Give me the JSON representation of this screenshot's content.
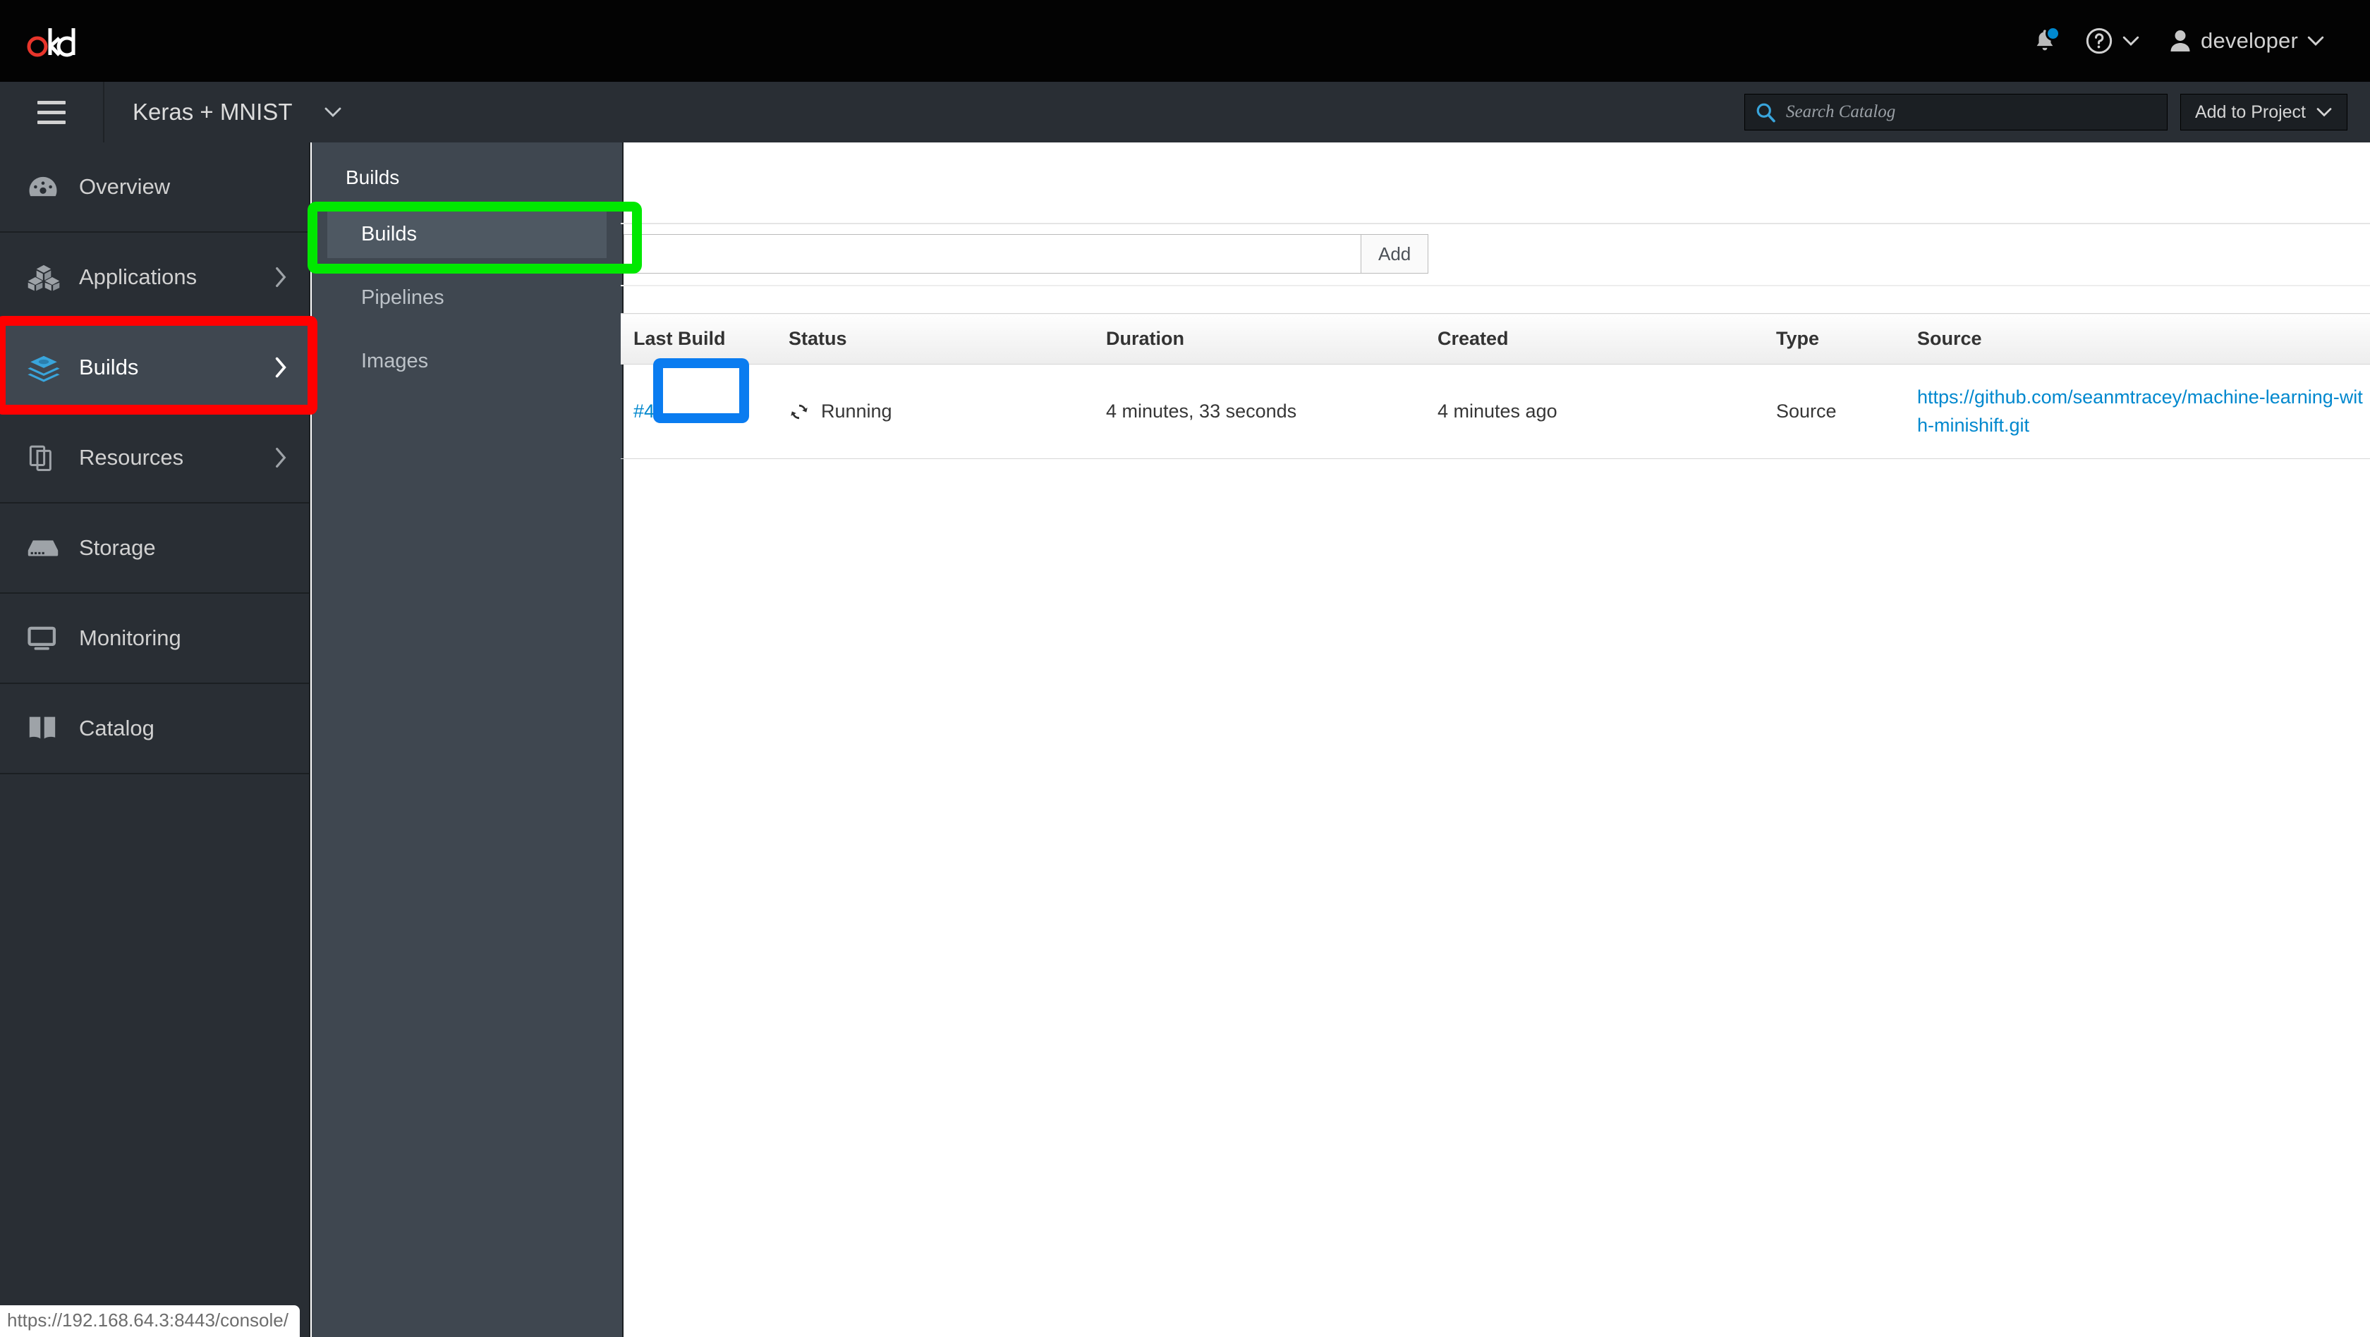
{
  "masthead": {
    "logo_text": "okd",
    "logo_color_accent": "#e8352b",
    "notifications_icon": "bell-icon",
    "notification_badge_color": "#0088ce",
    "help_icon": "help-circle-icon",
    "user_icon": "user-avatar-icon",
    "user_name": "developer"
  },
  "secondary_bar": {
    "menu_icon": "hamburger-menu-icon",
    "project_name": "Keras + MNIST",
    "project_caret_icon": "chevron-down-icon",
    "search": {
      "icon": "search-icon",
      "icon_color": "#39a5dc",
      "placeholder": "Search Catalog",
      "value": ""
    },
    "add_to_project_label": "Add to Project",
    "add_to_project_caret": "chevron-down-icon"
  },
  "sidebar": {
    "items": [
      {
        "label": "Overview",
        "icon": "dashboard-gauge-icon",
        "has_caret": false,
        "active": false
      },
      {
        "label": "Applications",
        "icon": "cubes-icon",
        "has_caret": true,
        "active": false
      },
      {
        "label": "Builds",
        "icon": "layers-stack-icon",
        "has_caret": true,
        "active": true
      },
      {
        "label": "Resources",
        "icon": "documents-icon",
        "has_caret": true,
        "active": false
      },
      {
        "label": "Storage",
        "icon": "storage-drive-icon",
        "has_caret": false,
        "active": false
      },
      {
        "label": "Monitoring",
        "icon": "monitor-screen-icon",
        "has_caret": false,
        "active": false
      },
      {
        "label": "Catalog",
        "icon": "open-book-icon",
        "has_caret": false,
        "active": false
      }
    ],
    "active_icon_color": "#39a5dc"
  },
  "flyout": {
    "title": "Builds",
    "items": [
      {
        "label": "Builds",
        "active": true
      },
      {
        "label": "Pipelines",
        "active": false
      },
      {
        "label": "Images",
        "active": false
      }
    ]
  },
  "main": {
    "filter": {
      "value": "",
      "placeholder": ""
    },
    "add_button_label": "Add",
    "table": {
      "headers": [
        "Last Build",
        "Status",
        "Duration",
        "Created",
        "Type",
        "Source"
      ],
      "rows": [
        {
          "last_build": "#4",
          "status_icon": "sync-refresh-icon",
          "status": "Running",
          "duration": "4 minutes, 33 seconds",
          "created": "4 minutes ago",
          "type": "Source",
          "source_url": "https://github.com/seanmtracey/machine-learning-with-minishift.git",
          "source_line1": "https://github.com/seanmtracey/mach",
          "source_line2": "ine-learning-with-minishift.git"
        }
      ]
    }
  },
  "status_bar": {
    "url": "https://192.168.64.3:8443/console/"
  },
  "annotations": {
    "red_box": {
      "color": "#ff0000",
      "target": "sidebar-item-builds"
    },
    "green_box": {
      "color": "#00e800",
      "target": "flyout-item-builds"
    },
    "blue_box": {
      "color": "#0a7cf0",
      "target": "build-number-link"
    }
  }
}
